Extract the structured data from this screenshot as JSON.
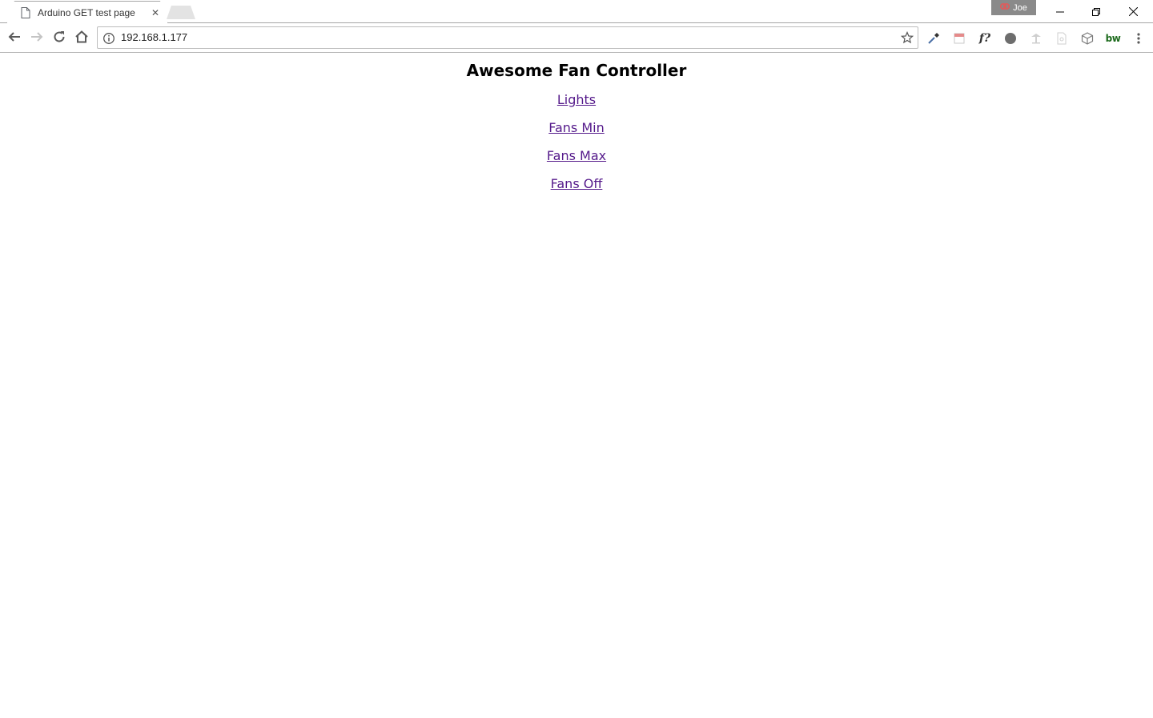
{
  "browser": {
    "tab": {
      "title": "Arduino GET test page",
      "close_glyph": "✕",
      "favicon": "page-icon"
    },
    "profile_name": "Joe",
    "window_controls": [
      "minimize-icon",
      "restore-icon",
      "close-icon"
    ],
    "omnibox": {
      "url": "192.168.1.177",
      "info_icon": "info-icon",
      "star_icon": "star-icon"
    },
    "nav_icons": [
      "back-arrow-icon",
      "forward-arrow-icon",
      "reload-icon",
      "home-icon"
    ],
    "extensions": [
      "eyedropper-icon",
      "calendar-icon",
      "font-icon",
      "compass-icon",
      "tree-icon",
      "document-icon",
      "cube-icon",
      "bw-icon",
      "menu-dots-icon"
    ],
    "extension_labels": {
      "font": "f?",
      "bw": "bw"
    }
  },
  "page": {
    "title": "Awesome Fan Controller",
    "links": [
      "Lights",
      "Fans Min",
      "Fans Max",
      "Fans Off"
    ],
    "link_color": "#551a8b"
  }
}
